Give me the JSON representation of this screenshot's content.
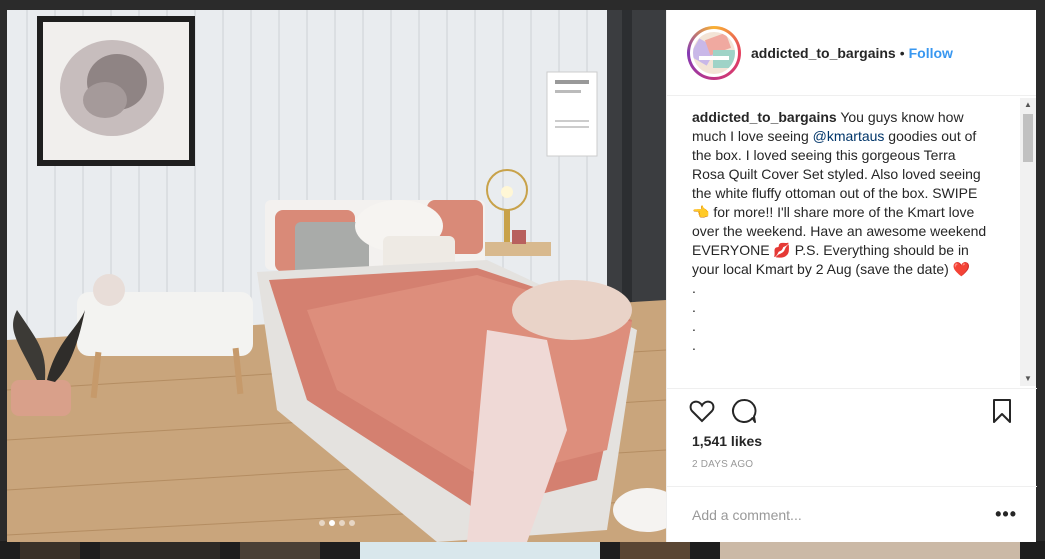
{
  "post": {
    "username": "addicted_to_bargains",
    "separator": "•",
    "follow_label": "Follow",
    "caption_user": "addicted_to_bargains",
    "caption_part1": " You guys know how much I love seeing ",
    "caption_mention": "@kmartaus",
    "caption_part2": " goodies out of the box. I loved seeing this gorgeous Terra Rosa Quilt Cover Set styled. Also loved seeing the white fluffy ottoman out of the box. SWIPE 👈 for more!! I'll share more of the Kmart love over the weekend. Have an awesome weekend EVERYONE 💋 P.S. Everything should be in your local Kmart by 2 Aug (save the date) ❤️",
    "caption_dots": [
      ".",
      ".",
      ".",
      "."
    ],
    "likes": "1,541 likes",
    "time_ago": "2 DAYS AGO",
    "comment_placeholder": "Add a comment...",
    "more_label": "•••"
  },
  "carousel": {
    "slides": 4,
    "active_index": 1
  },
  "icons": [
    "heart-icon",
    "comment-icon",
    "bookmark-icon"
  ]
}
